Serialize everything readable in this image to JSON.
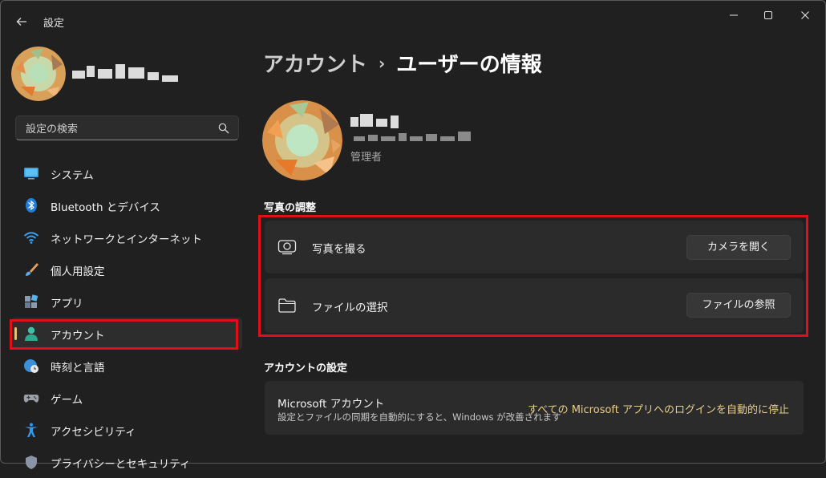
{
  "window": {
    "title": "設定",
    "back_icon": "back-arrow-icon",
    "controls": [
      "minimize-icon",
      "maximize-icon",
      "close-icon"
    ]
  },
  "search": {
    "placeholder": "設定の検索",
    "icon": "search-icon"
  },
  "sidebar": {
    "items": [
      {
        "label": "システム",
        "icon": "system-icon"
      },
      {
        "label": "Bluetooth とデバイス",
        "icon": "bluetooth-icon"
      },
      {
        "label": "ネットワークとインターネット",
        "icon": "wifi-icon"
      },
      {
        "label": "個人用設定",
        "icon": "brush-icon"
      },
      {
        "label": "アプリ",
        "icon": "apps-icon"
      },
      {
        "label": "アカウント",
        "icon": "account-icon",
        "active": true
      },
      {
        "label": "時刻と言語",
        "icon": "globe-clock-icon"
      },
      {
        "label": "ゲーム",
        "icon": "gamepad-icon"
      },
      {
        "label": "アクセシビリティ",
        "icon": "accessibility-icon"
      },
      {
        "label": "プライバシーとセキュリティ",
        "icon": "shield-icon"
      }
    ]
  },
  "header": {
    "breadcrumb_parent": "アカウント",
    "breadcrumb_sep": "›",
    "page_title": "ユーザーの情報"
  },
  "profile": {
    "role": "管理者"
  },
  "photo_section": {
    "title": "写真の調整",
    "take_photo": {
      "label": "写真を撮る",
      "button": "カメラを開く",
      "icon": "camera-icon"
    },
    "choose_file": {
      "label": "ファイルの選択",
      "button": "ファイルの参照",
      "icon": "folder-icon"
    }
  },
  "account_section": {
    "title": "アカウントの設定",
    "ms_title": "Microsoft アカウント",
    "ms_desc": "設定とファイルの同期を自動的にすると、Windows が改善されます",
    "ms_link": "すべての Microsoft アプリへのログインを自動的に停止"
  },
  "colors": {
    "background": "#202020",
    "card": "#2b2b2b",
    "accent": "#e6c178",
    "highlight_frame": "#e0101a",
    "link": "#e8cf8a"
  }
}
